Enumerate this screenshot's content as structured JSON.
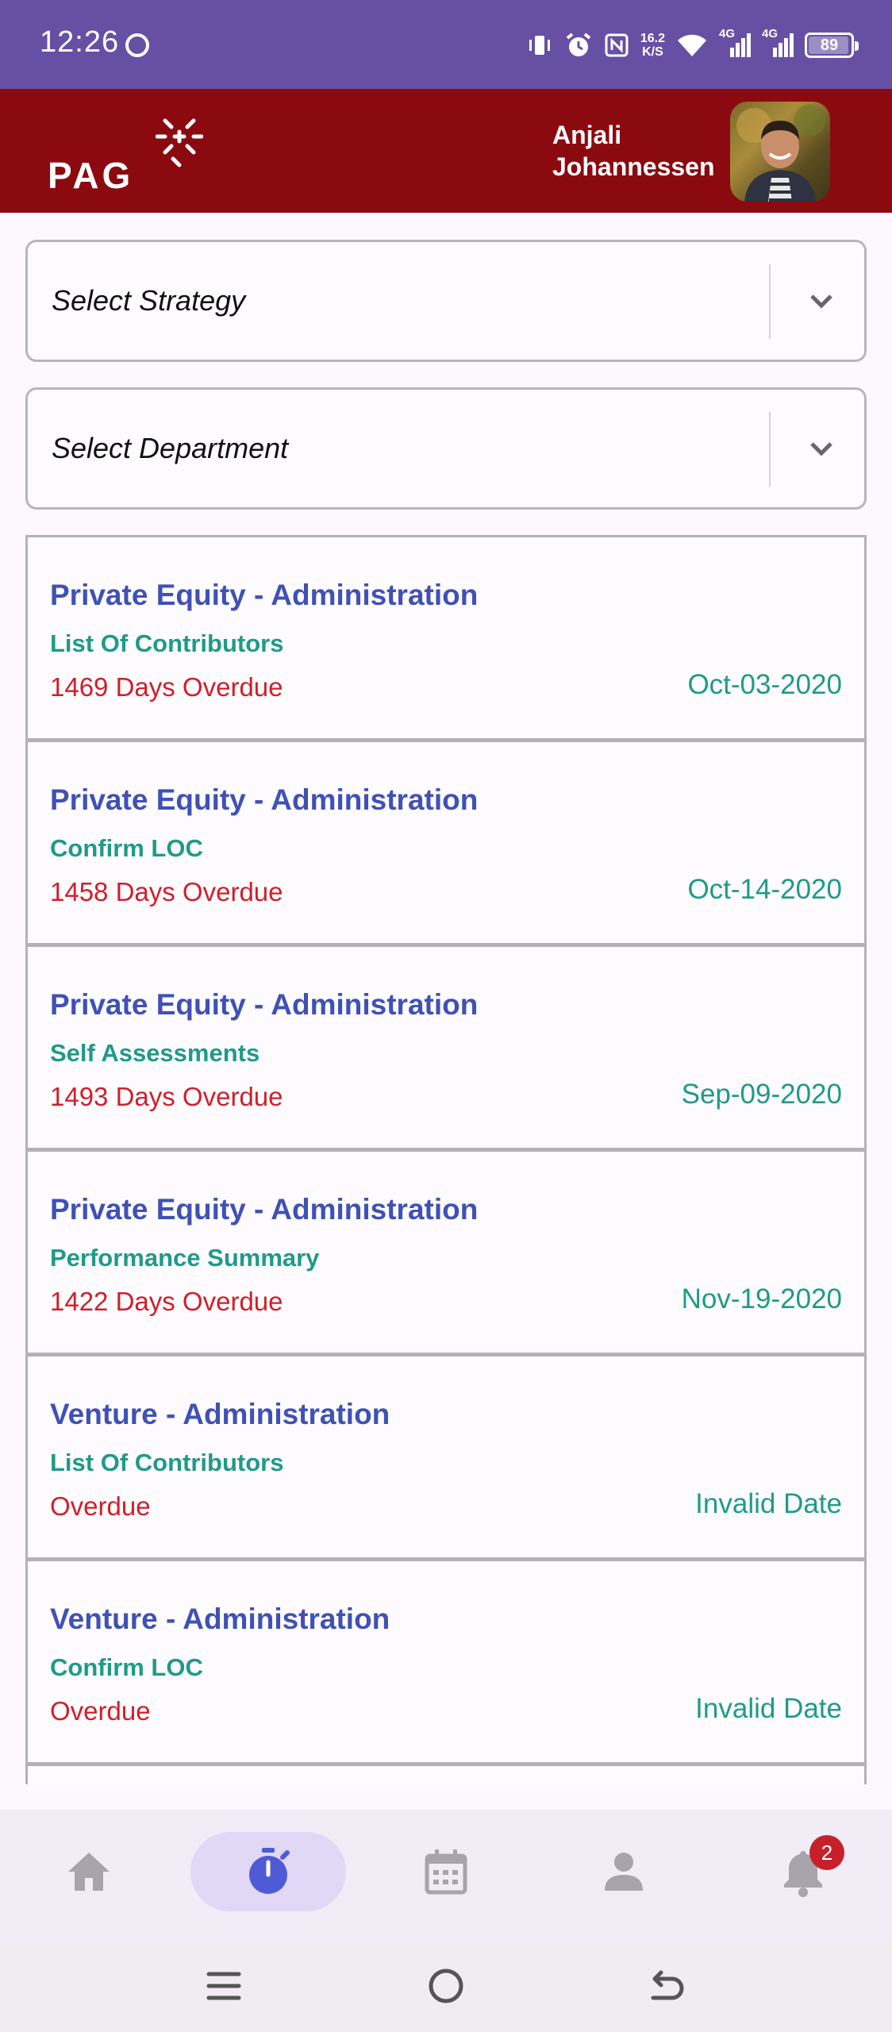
{
  "status_bar": {
    "time": "12:26",
    "speed_top": "16.2",
    "speed_bottom": "K/S",
    "network_1": "4G",
    "network_2": "4G",
    "battery": "89",
    "battery_level": 0.89,
    "icons": [
      "face-icon",
      "vibrate-icon",
      "alarm-icon",
      "nfc-icon",
      "wifi-icon",
      "signal-icon",
      "signal-icon",
      "battery-icon"
    ]
  },
  "header": {
    "logo_text": "PAG",
    "user_name_first": "Anjali",
    "user_name_last": "Johannessen",
    "brand_color": "#8b0a10",
    "status_color": "#6750a4"
  },
  "filters": {
    "strategy_placeholder": "Select Strategy",
    "department_placeholder": "Select Department"
  },
  "tasks": [
    {
      "title": "Private Equity - Administration",
      "subtitle": "List Of Contributors",
      "overdue": "1469 Days Overdue",
      "date": "Oct-03-2020"
    },
    {
      "title": "Private Equity - Administration",
      "subtitle": "Confirm LOC",
      "overdue": "1458 Days Overdue",
      "date": "Oct-14-2020"
    },
    {
      "title": "Private Equity - Administration",
      "subtitle": "Self Assessments",
      "overdue": "1493 Days Overdue",
      "date": "Sep-09-2020"
    },
    {
      "title": "Private Equity - Administration",
      "subtitle": "Performance Summary",
      "overdue": "1422 Days Overdue",
      "date": "Nov-19-2020"
    },
    {
      "title": "Venture - Administration",
      "subtitle": "List Of Contributors",
      "overdue": "Overdue",
      "date": "Invalid Date"
    },
    {
      "title": "Venture - Administration",
      "subtitle": "Confirm LOC",
      "overdue": "Overdue",
      "date": "Invalid Date"
    }
  ],
  "bottom_nav": {
    "items": [
      "home-icon",
      "timer-icon",
      "calendar-icon",
      "person-icon",
      "bell-icon"
    ],
    "active": "timer-icon",
    "notification_count": "2"
  },
  "system_nav": {
    "icons": [
      "menu-icon",
      "home-circle-icon",
      "back-icon"
    ]
  }
}
